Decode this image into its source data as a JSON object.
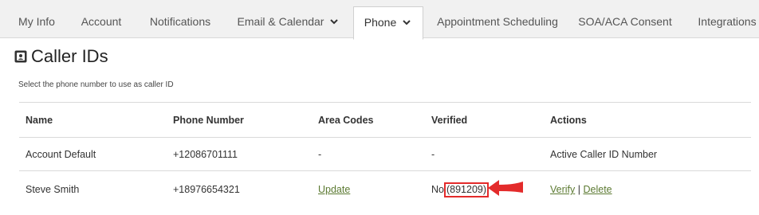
{
  "tabs": [
    {
      "label": "My Info"
    },
    {
      "label": "Account"
    },
    {
      "label": "Notifications"
    },
    {
      "label": "Email & Calendar"
    },
    {
      "label": "Phone"
    },
    {
      "label": "Appointment Scheduling"
    },
    {
      "label": "SOA/ACA Consent"
    },
    {
      "label": "Integrations"
    }
  ],
  "page": {
    "title": "Caller IDs",
    "subtitle": "Select the phone number to use as caller ID"
  },
  "table": {
    "headers": [
      "Name",
      "Phone Number",
      "Area Codes",
      "Verified",
      "Actions"
    ],
    "rows": [
      {
        "name": "Account Default",
        "phone": "+12086701111",
        "area_codes": "-",
        "verified": "-",
        "action": "Active Caller ID Number"
      },
      {
        "name": "Steve Smith",
        "phone": "+18976654321",
        "area_codes": "Update",
        "verified": "No",
        "code": "(891209)",
        "verify_label": "Verify",
        "separator": "|",
        "delete_label": "Delete"
      }
    ]
  },
  "colors": {
    "link": "#5c7a32",
    "highlight": "#e32b2b"
  }
}
